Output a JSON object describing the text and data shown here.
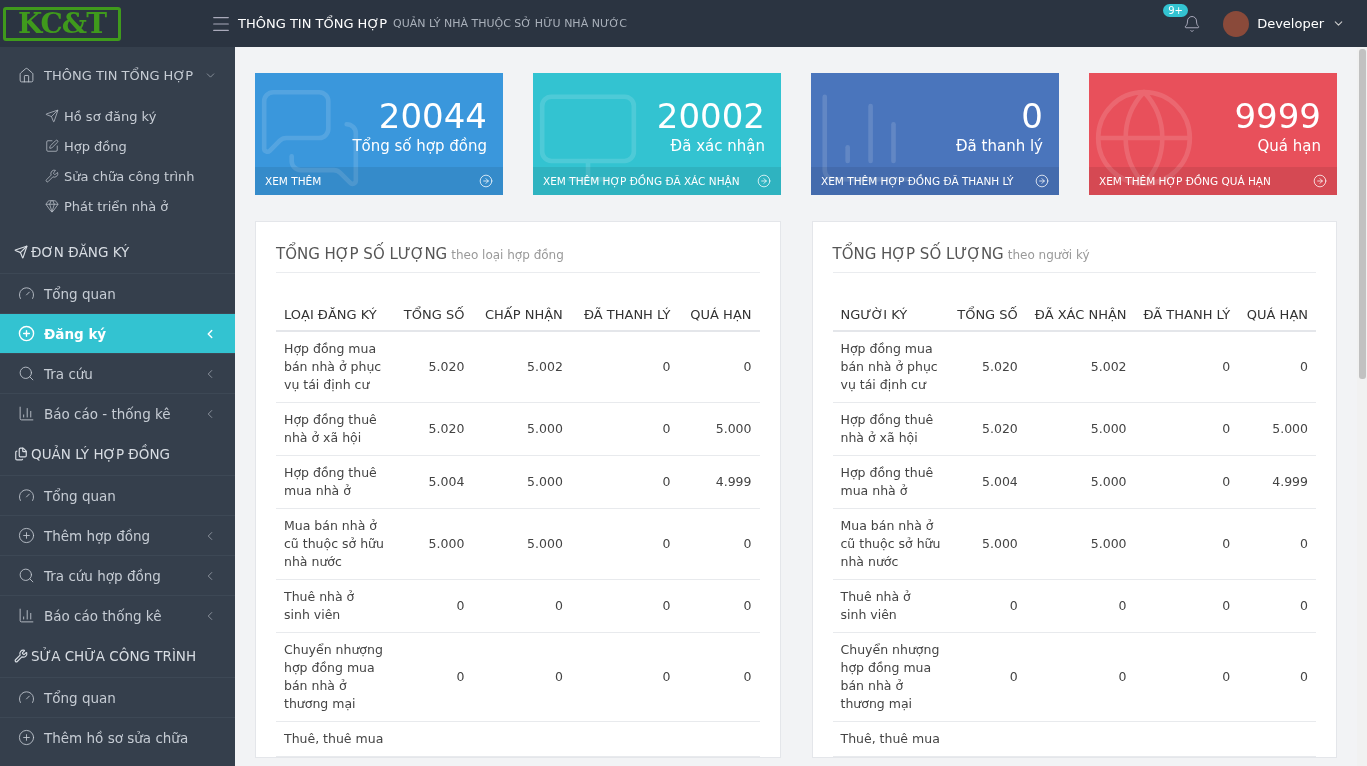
{
  "logo": "KC&T",
  "topbar": {
    "title": "THÔNG TIN TỔNG HỢP",
    "subtitle": "QUẢN LÝ NHÀ THUỘC SỞ HỮU NHÀ NƯỚC",
    "notification_count": "9+",
    "user": "Developer"
  },
  "sidebar": {
    "items": [
      {
        "kind": "group",
        "label": "THÔNG TIN TỔNG HỢP",
        "expanded": true,
        "children": [
          {
            "label": "Hồ sơ đăng ký"
          },
          {
            "label": "Hợp đồng"
          },
          {
            "label": "Sửa chữa công trình"
          },
          {
            "label": "Phát triển nhà ở"
          }
        ]
      },
      {
        "kind": "section",
        "label": "ĐƠN ĐĂNG KÝ"
      },
      {
        "kind": "item",
        "label": "Tổng quan",
        "selected": false,
        "submenu": false
      },
      {
        "kind": "item",
        "label": "Đăng ký",
        "selected": true,
        "submenu": true
      },
      {
        "kind": "item",
        "label": "Tra cứu",
        "selected": false,
        "submenu": true
      },
      {
        "kind": "item",
        "label": "Báo cáo - thống kê",
        "selected": false,
        "submenu": true
      },
      {
        "kind": "section",
        "label": "QUẢN LÝ HỢP ĐỒNG"
      },
      {
        "kind": "item",
        "label": "Tổng quan",
        "selected": false,
        "submenu": false
      },
      {
        "kind": "item",
        "label": "Thêm hợp đồng",
        "selected": false,
        "submenu": true
      },
      {
        "kind": "item",
        "label": "Tra cứu hợp đồng",
        "selected": false,
        "submenu": true
      },
      {
        "kind": "item",
        "label": "Báo cáo thống kê",
        "selected": false,
        "submenu": true
      },
      {
        "kind": "section",
        "label": "SỬA CHỮA CÔNG TRÌNH"
      },
      {
        "kind": "item",
        "label": "Tổng quan",
        "selected": false,
        "submenu": false
      },
      {
        "kind": "item",
        "label": "Thêm hồ sơ sửa chữa",
        "selected": false,
        "submenu": false
      }
    ]
  },
  "stats": [
    {
      "value": "20044",
      "label": "Tổng số hợp đồng",
      "link": "XEM THÊM",
      "color": "#3a97dc"
    },
    {
      "value": "20002",
      "label": "Đã xác nhận",
      "link": "XEM THÊM HỢP ĐỒNG ĐÃ XÁC NHẬN",
      "color": "#33c3d1"
    },
    {
      "value": "0",
      "label": "Đã thanh lý",
      "link": "XEM THÊM HỢP ĐỒNG ĐÃ THANH LÝ",
      "color": "#4a75bc"
    },
    {
      "value": "9999",
      "label": "Quá hạn",
      "link": "XEM THÊM HỢP ĐỒNG QUÁ HẠN",
      "color": "#e8505b"
    }
  ],
  "tables": [
    {
      "title": "TỔNG HỢP SỐ LƯỢNG",
      "subtitle": "theo loại hợp đồng",
      "columns": [
        "LOẠI ĐĂNG KÝ",
        "TỔNG SỐ",
        "CHẤP NHẬN",
        "ĐÃ THANH LÝ",
        "QUÁ HẠN"
      ],
      "rows": [
        [
          "Hợp đồng mua bán nhà ở phục vụ tái định cư",
          "5.020",
          "5.002",
          "0",
          "0"
        ],
        [
          "Hợp đồng thuê nhà ở xã hội",
          "5.020",
          "5.000",
          "0",
          "5.000"
        ],
        [
          "Hợp đồng thuê mua nhà ở",
          "5.004",
          "5.000",
          "0",
          "4.999"
        ],
        [
          "Mua bán nhà ở cũ thuộc sở hữu nhà nước",
          "5.000",
          "5.000",
          "0",
          "0"
        ],
        [
          "Thuê nhà ở sinh viên",
          "0",
          "0",
          "0",
          "0"
        ],
        [
          "Chuyển nhượng hợp đồng mua bán nhà ở thương mại",
          "0",
          "0",
          "0",
          "0"
        ],
        [
          "Thuê, thuê mua"
        ]
      ]
    },
    {
      "title": "TỔNG HỢP SỐ LƯỢNG",
      "subtitle": "theo người ký",
      "columns": [
        "NGƯỜI KÝ",
        "TỔNG SỐ",
        "ĐÃ XÁC NHẬN",
        "ĐÃ THANH LÝ",
        "QUÁ HẠN"
      ],
      "rows": [
        [
          "Hợp đồng mua bán nhà ở phục vụ tái định cư",
          "5.020",
          "5.002",
          "0",
          "0"
        ],
        [
          "Hợp đồng thuê nhà ở xã hội",
          "5.020",
          "5.000",
          "0",
          "5.000"
        ],
        [
          "Hợp đồng thuê mua nhà ở",
          "5.004",
          "5.000",
          "0",
          "4.999"
        ],
        [
          "Mua bán nhà ở cũ thuộc sở hữu nhà nước",
          "5.000",
          "5.000",
          "0",
          "0"
        ],
        [
          "Thuê nhà ở sinh viên",
          "0",
          "0",
          "0",
          "0"
        ],
        [
          "Chuyển nhượng hợp đồng mua bán nhà ở thương mại",
          "0",
          "0",
          "0",
          "0"
        ],
        [
          "Thuê, thuê mua"
        ]
      ]
    }
  ]
}
